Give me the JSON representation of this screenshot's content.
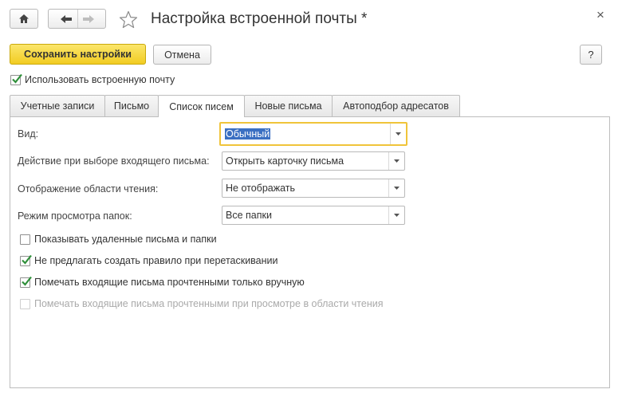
{
  "window": {
    "title": "Настройка встроенной почты *",
    "close_label": "×"
  },
  "toolbar": {
    "save_label": "Сохранить настройки",
    "cancel_label": "Отмена",
    "help_label": "?"
  },
  "use_builtin_mail": {
    "label": "Использовать встроенную почту",
    "checked": true
  },
  "tabs": [
    {
      "label": "Учетные записи",
      "active": false
    },
    {
      "label": "Письмо",
      "active": false
    },
    {
      "label": "Список писем",
      "active": true
    },
    {
      "label": "Новые письма",
      "active": false
    },
    {
      "label": "Автоподбор адресатов",
      "active": false
    }
  ],
  "fields": [
    {
      "label": "Вид:",
      "value": "Обычный"
    },
    {
      "label": "Действие при выборе входящего письма:",
      "value": "Открыть карточку письма"
    },
    {
      "label": "Отображение области чтения:",
      "value": "Не отображать"
    },
    {
      "label": "Режим просмотра папок:",
      "value": "Все папки"
    }
  ],
  "options": [
    {
      "label": "Показывать удаленные письма и папки",
      "checked": false,
      "enabled": true
    },
    {
      "label": "Не предлагать создать правило при перетаскивании",
      "checked": true,
      "enabled": true
    },
    {
      "label": "Помечать входящие письма прочтенными только вручную",
      "checked": true,
      "enabled": true
    },
    {
      "label": "Помечать входящие письма прочтенными при просмотре в области чтения",
      "checked": false,
      "enabled": false
    }
  ],
  "icons": {
    "home": "home-icon",
    "back": "arrow-left-icon",
    "forward": "arrow-right-icon",
    "favorite": "star-icon",
    "dropdown": "chevron-down-icon",
    "check": "checkmark-icon"
  },
  "colors": {
    "primary_button": "#f2cc22",
    "focus_border": "#f0c43a",
    "selection": "#3a6fc2",
    "checkmark": "#2f8f3a"
  }
}
